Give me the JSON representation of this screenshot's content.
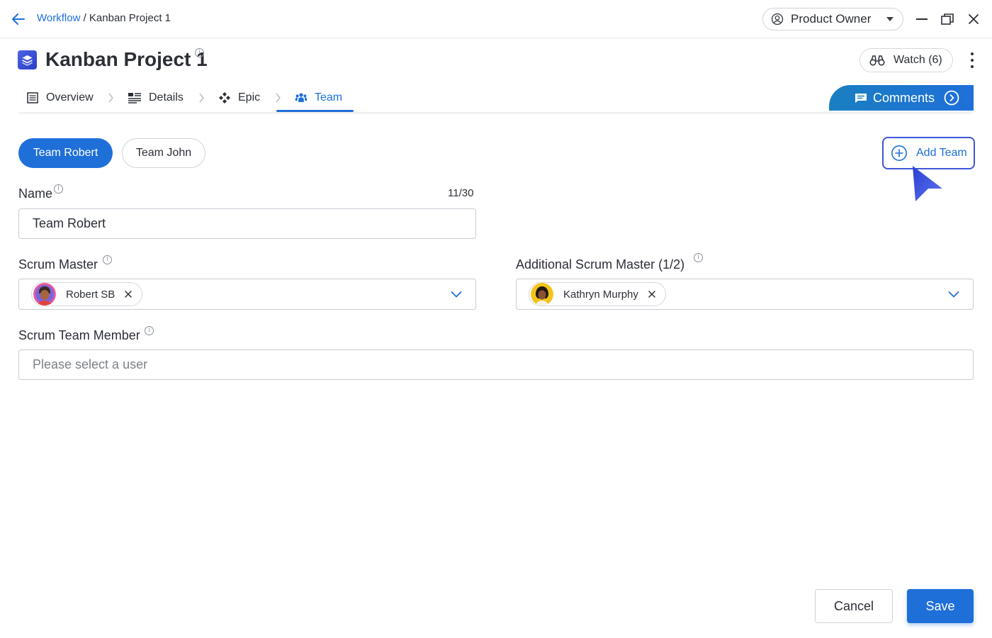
{
  "colors": {
    "accent": "#1f6fd9",
    "border": "#c7ccd2",
    "text": "#2b2f36",
    "cursor": "#3f56d6"
  },
  "topbar": {
    "back_icon": "arrow-left-icon",
    "breadcrumb": {
      "parent": "Workflow",
      "separator": " / ",
      "current": "Kanban Project 1"
    },
    "role": {
      "label": "Product Owner",
      "icon": "user-circle-icon"
    },
    "window_controls": [
      "minimize-icon",
      "restore-icon",
      "close-icon"
    ]
  },
  "header": {
    "title": "Kanban Project 1",
    "info": "i",
    "watch_label": "Watch (6)",
    "watch_icon": "binoculars-icon",
    "more_icon": "kebab-menu-icon"
  },
  "tabs": [
    {
      "label": "Overview",
      "icon": "list-icon",
      "active": false
    },
    {
      "label": "Details",
      "icon": "details-icon",
      "active": false
    },
    {
      "label": "Epic",
      "icon": "epic-icon",
      "active": false
    },
    {
      "label": "Team",
      "icon": "team-icon",
      "active": true
    }
  ],
  "comments": {
    "label": "Comments",
    "icon": "comment-icon"
  },
  "teams": {
    "items": [
      {
        "label": "Team Robert",
        "active": true
      },
      {
        "label": "Team John",
        "active": false
      }
    ],
    "add_label": "Add Team"
  },
  "form": {
    "name": {
      "label": "Name",
      "counter": "11/30",
      "value": "Team Robert",
      "info": "i"
    },
    "scrum_master": {
      "label": "Scrum Master",
      "info": "i",
      "chip": "Robert SB"
    },
    "additional_scrum_master": {
      "label": "Additional Scrum Master (1/2)",
      "info": "i",
      "chip": "Kathryn Murphy"
    },
    "scrum_team_member": {
      "label": "Scrum Team Member",
      "info": "i",
      "placeholder": "Please select a user"
    }
  },
  "footer": {
    "cancel_label": "Cancel",
    "save_label": "Save"
  }
}
